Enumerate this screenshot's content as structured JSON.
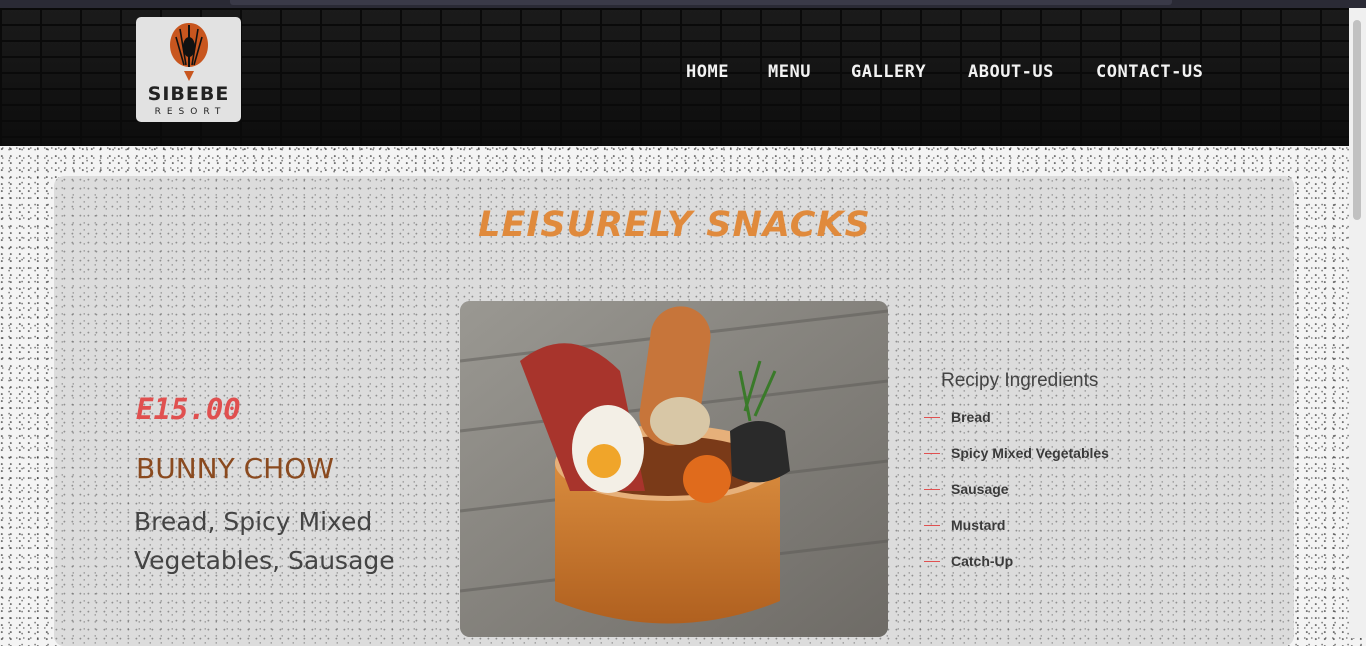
{
  "logo": {
    "name": "SIBEBE",
    "sub": "RESORT"
  },
  "nav": {
    "items": [
      "HOME",
      "MENU",
      "GALLERY",
      "ABOUT-US",
      "CONTACT-US"
    ]
  },
  "section": {
    "title": "LEISURELY SNACKS"
  },
  "item": {
    "price": "E15.00",
    "name": "BUNNY CHOW",
    "description": "Bread, Spicy Mixed Vegetables, Sausage"
  },
  "ingredients": {
    "title": "Recipy Ingredients",
    "items": [
      "Bread",
      "Spicy Mixed Vegetables",
      "Sausage",
      "Mustard",
      "Catch-Up"
    ]
  },
  "colors": {
    "accent": "#e08a3c",
    "price": "#e0504f",
    "dish": "#8a4a1f",
    "dash": "#e05050"
  }
}
